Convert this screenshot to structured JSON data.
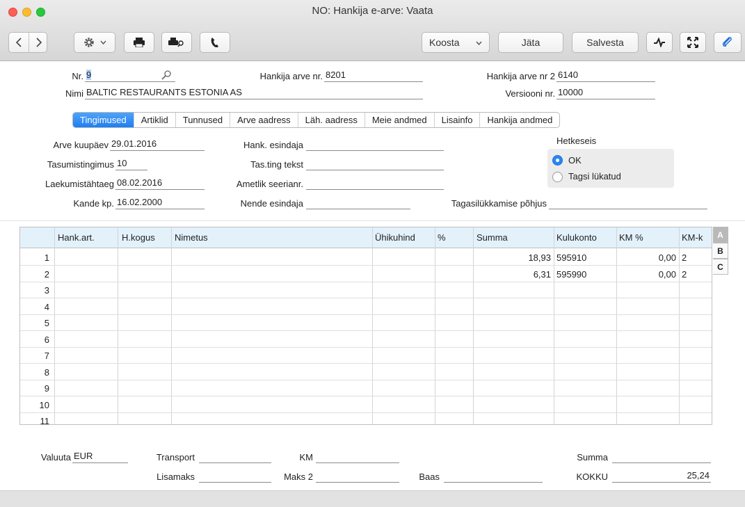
{
  "window": {
    "title": "NO: Hankija e-arve: Vaata"
  },
  "toolbar": {
    "koosta_label": "Koosta",
    "jata_label": "Jäta",
    "salvesta_label": "Salvesta"
  },
  "header": {
    "nr_label": "Nr.",
    "nr_value": "9",
    "hank_arve_label": "Hankija arve nr.",
    "hank_arve_value": "8201",
    "hank_arve2_label": "Hankija arve nr 2",
    "hank_arve2_value": "6140",
    "nimi_label": "Nimi",
    "nimi_value": "BALTIC RESTAURANTS ESTONIA AS",
    "versioon_label": "Versiooni nr.",
    "versioon_value": "10000"
  },
  "tabs": [
    "Tingimused",
    "Artiklid",
    "Tunnused",
    "Arve aadress",
    "Läh. aadress",
    "Meie andmed",
    "Lisainfo",
    "Hankija andmed"
  ],
  "conditions": {
    "arve_kuupaev_label": "Arve kuupäev",
    "arve_kuupaev_value": "29.01.2016",
    "tasumis_label": "Tasumistingimus",
    "tasumis_value": "10",
    "laekumis_label": "Laekumistähtaeg",
    "laekumis_value": "08.02.2016",
    "kande_label": "Kande kp.",
    "kande_value": "16.02.2000",
    "hank_esindaja_label": "Hank. esindaja",
    "tas_ting_label": "Tas.ting tekst",
    "ametlik_label": "Ametlik seerianr.",
    "nende_label": "Nende esindaja",
    "tagasi_pohjus_label": "Tagasilükkamise põhjus",
    "hetkeseis_label": "Hetkeseis",
    "status_ok": "OK",
    "status_rejected": "Tagsi lükatud"
  },
  "grid": {
    "columns": [
      "Hank.art.",
      "H.kogus",
      "Nimetus",
      "Ühikuhind",
      "%",
      "Summa",
      "Kulukonto",
      "KM %",
      "KM-k"
    ],
    "rows": [
      {
        "num": "1",
        "summa": "18,93",
        "kulukonto": "595910",
        "km": "0,00",
        "kmk": "2"
      },
      {
        "num": "2",
        "summa": "6,31",
        "kulukonto": "595990",
        "km": "0,00",
        "kmk": "2"
      },
      {
        "num": "3"
      },
      {
        "num": "4"
      },
      {
        "num": "5"
      },
      {
        "num": "6"
      },
      {
        "num": "7"
      },
      {
        "num": "8"
      },
      {
        "num": "9"
      },
      {
        "num": "10"
      },
      {
        "num": "11"
      }
    ],
    "side_tabs": [
      "A",
      "B",
      "C"
    ]
  },
  "footer": {
    "valuuta_label": "Valuuta",
    "valuuta_value": "EUR",
    "transport_label": "Transport",
    "km_label": "KM",
    "summa_label": "Summa",
    "lisamaks_label": "Lisamaks",
    "maks2_label": "Maks 2",
    "baas_label": "Baas",
    "kokku_label": "KOKKU",
    "kokku_value": "25,24"
  }
}
